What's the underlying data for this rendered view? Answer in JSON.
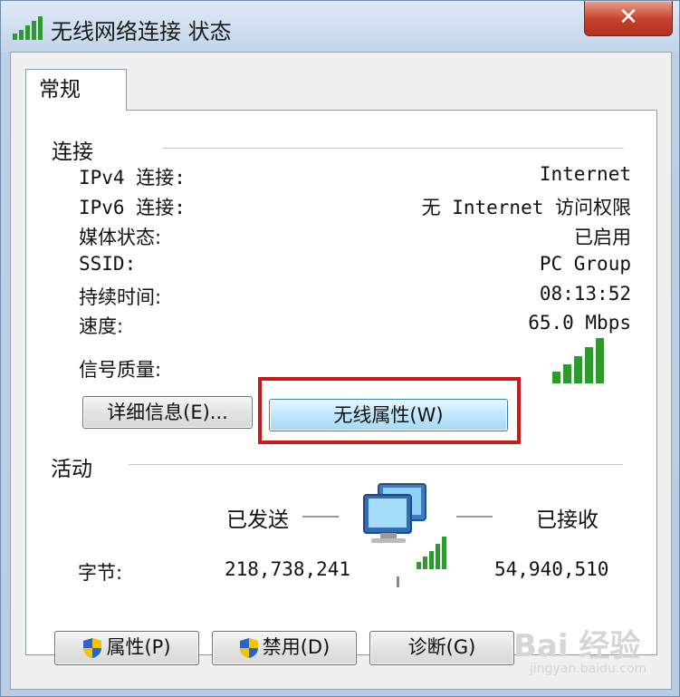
{
  "window": {
    "title": "无线网络连接 状态",
    "close_glyph": "✕"
  },
  "tabs": [
    {
      "label": "常规"
    }
  ],
  "connection": {
    "section_title": "连接",
    "rows": [
      {
        "label": "IPv4 连接:",
        "value": "Internet"
      },
      {
        "label": "IPv6 连接:",
        "value": "无 Internet 访问权限"
      },
      {
        "label": "媒体状态:",
        "value": "已启用"
      },
      {
        "label": "SSID:",
        "value": "PC Group"
      },
      {
        "label": "持续时间:",
        "value": "08:13:52"
      },
      {
        "label": "速度:",
        "value": "65.0 Mbps"
      }
    ],
    "signal_label": "信号质量:",
    "signal_bars": 5,
    "details_button": "详细信息(E)...",
    "wireless_props_button": "无线属性(W)"
  },
  "activity": {
    "section_title": "活动",
    "sent_label": "已发送",
    "received_label": "已接收",
    "bytes_label": "字节:",
    "bytes_sent": "218,738,241",
    "bytes_received": "54,940,510"
  },
  "buttons": {
    "properties": "属性(P)",
    "disable": "禁用(D)",
    "diagnose": "诊断(G)"
  },
  "watermark": {
    "text": "Bai 经验",
    "sub": "jingyan.baidu.com"
  },
  "colors": {
    "highlight": "#cc1a1a",
    "signal": "#2e9a2e"
  }
}
